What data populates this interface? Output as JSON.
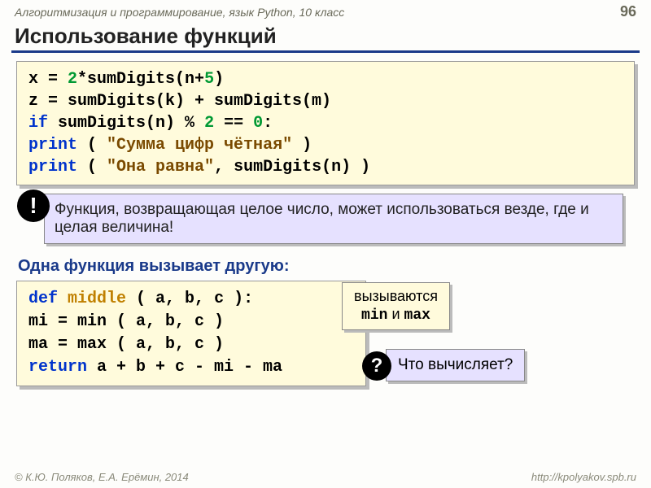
{
  "header": {
    "subject": "Алгоритмизация и программирование, язык Python, 10 класс",
    "page": "96"
  },
  "title": "Использование функций",
  "code1": {
    "l1a": "x = ",
    "l1b": "2",
    "l1c": "*sumDigits(n+",
    "l1d": "5",
    "l1e": ")",
    "l2": "z = sumDigits(k) + sumDigits(m)",
    "l3a": "if",
    "l3b": " sumDigits(n)",
    "l3c": " % ",
    "l3d": "2",
    "l3e": " == ",
    "l3f": "0",
    "l3g": ":",
    "l4a": "   ",
    "l4b": "print",
    "l4c": " ( ",
    "l4d": "\"Сумма цифр чётная\"",
    "l4e": " )",
    "l5a": "   ",
    "l5b": "print",
    "l5c": " ( ",
    "l5d": "\"Она равна\"",
    "l5e": ", sumDigits(n) )"
  },
  "note": {
    "icon": "!",
    "text": "Функция, возвращающая целое число, может использоваться везде, где и целая величина!"
  },
  "subheader": "Одна функция вызывает другую:",
  "code2": {
    "l1a": "def",
    "l1b": " ",
    "l1c": "middle",
    "l1d": " ( a, b, c ):",
    "l2": "  mi = min ( a, b, c )",
    "l3": "  ma = max ( a, b, c )",
    "l4a": "  ",
    "l4b": "return",
    "l4c": " a + b + c - mi - ma"
  },
  "callout": {
    "line1": "вызываются",
    "min": "min",
    "and": " и ",
    "max": "max"
  },
  "question": {
    "icon": "?",
    "text": "Что вычисляет?"
  },
  "footer": {
    "left": "© К.Ю. Поляков, Е.А. Ерёмин, 2014",
    "right": "http://kpolyakov.spb.ru"
  }
}
